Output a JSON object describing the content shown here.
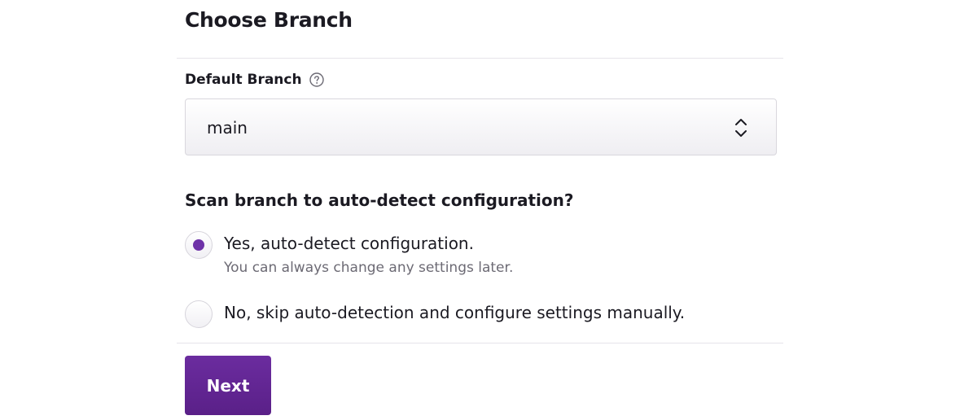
{
  "page": {
    "title": "Choose Branch"
  },
  "default_branch": {
    "label": "Default Branch",
    "help_icon": "question-circle-icon",
    "selected": "main",
    "chevron_icon": "up-down-chevron-icon"
  },
  "scan": {
    "question": "Scan branch to auto-detect configuration?",
    "options": [
      {
        "label": "Yes, auto-detect configuration.",
        "sublabel": "You can always change any settings later.",
        "selected": true
      },
      {
        "label": "No, skip auto-detection and configure settings manually.",
        "selected": false
      }
    ]
  },
  "actions": {
    "next_label": "Next"
  },
  "colors": {
    "accent": "#6e32a8",
    "button": "#64268f",
    "text": "#1b1a22",
    "muted_text": "#6c6a74",
    "divider": "#e6e4ea"
  }
}
